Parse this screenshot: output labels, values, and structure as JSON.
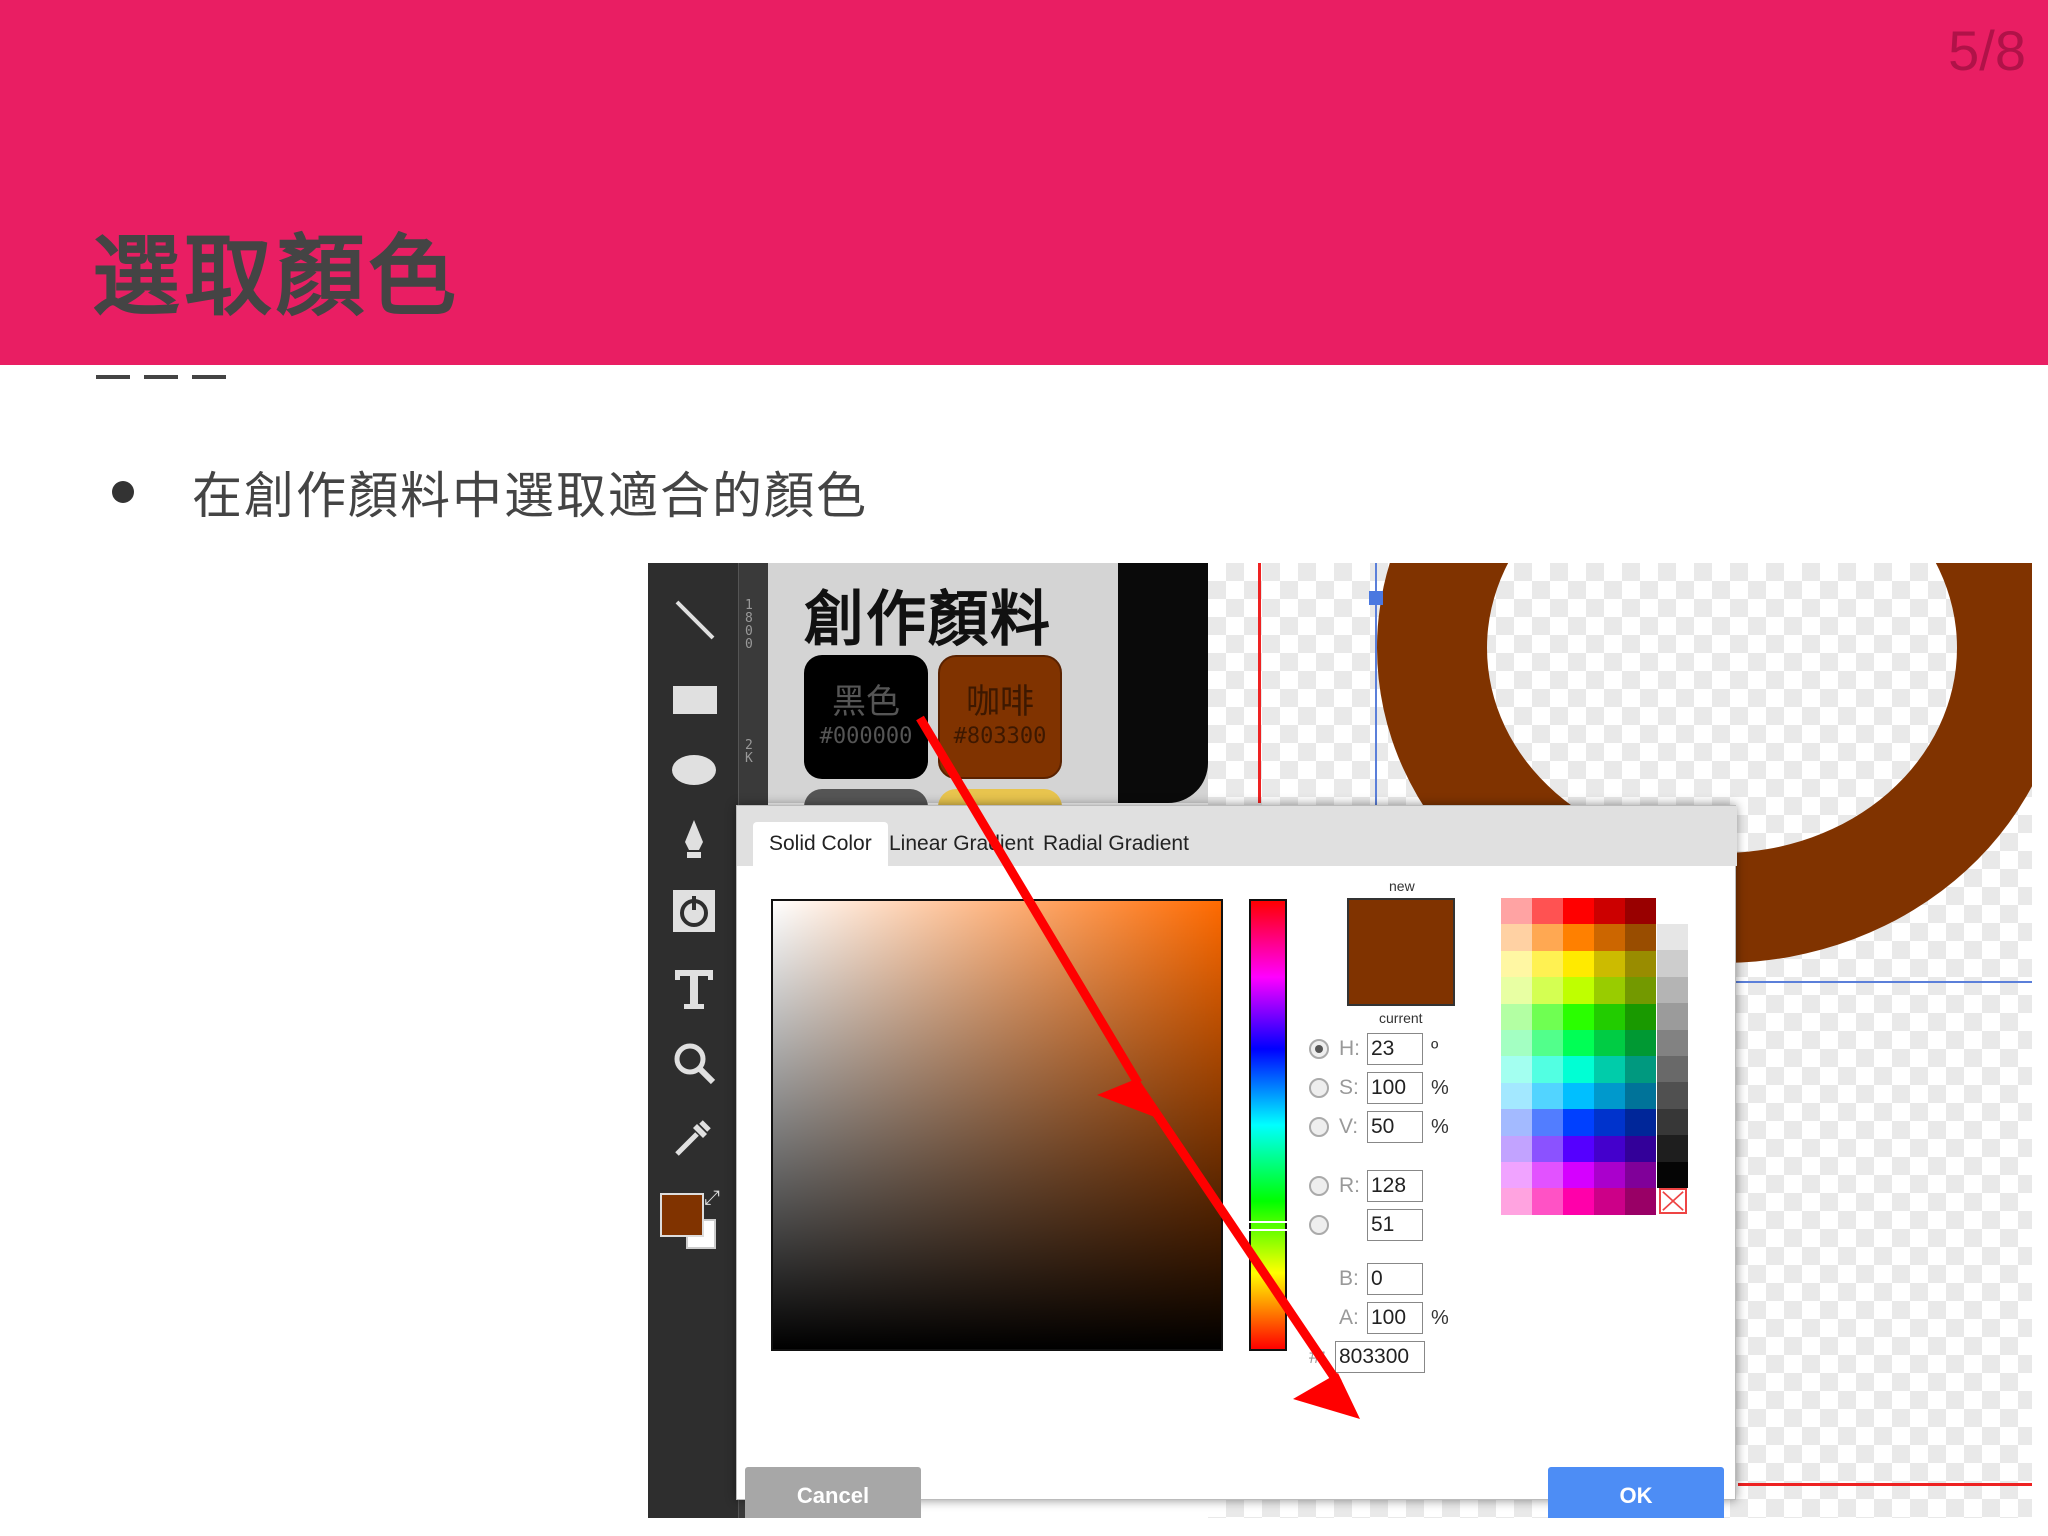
{
  "slide": {
    "page_number": "5/8",
    "title": "選取顏色",
    "bullet": "在創作顏料中選取適合的顏色"
  },
  "colors": {
    "banner": "#e91e63",
    "selected_color": "#803300",
    "ok_button": "#4d8df5",
    "cancel_button": "#a7a7a7",
    "arrow": "#ff0000"
  },
  "toolbar": {
    "tools": [
      "line-icon",
      "rectangle-icon",
      "ellipse-icon",
      "pen-icon",
      "shape-library-icon",
      "text-icon",
      "zoom-icon",
      "eyedropper-icon"
    ],
    "ruler_marks": [
      "1800",
      "2K"
    ]
  },
  "palette": {
    "title": "創作顏料",
    "chips": [
      {
        "name": "黑色",
        "hex": "#000000",
        "color": "#000000"
      },
      {
        "name": "咖啡",
        "hex": "#803300",
        "color": "#803300"
      }
    ]
  },
  "picker": {
    "tabs": [
      "Solid Color",
      "Linear Gradient",
      "Radial Gradient"
    ],
    "active_tab": "Solid Color",
    "preview_new_label": "new",
    "preview_current_label": "current",
    "fields": {
      "h": {
        "label": "H:",
        "value": "23",
        "unit": "º"
      },
      "s": {
        "label": "S:",
        "value": "100",
        "unit": "%"
      },
      "v": {
        "label": "V:",
        "value": "50",
        "unit": "%"
      },
      "r": {
        "label": "R:",
        "value": "128"
      },
      "g": {
        "label": "",
        "value": "51"
      },
      "b": {
        "label": "B:",
        "value": "0"
      },
      "a": {
        "label": "A:",
        "value": "100",
        "unit": "%"
      }
    },
    "hex_label": "#:",
    "hex_value": "803300",
    "cancel_label": "Cancel",
    "ok_label": "OK"
  }
}
